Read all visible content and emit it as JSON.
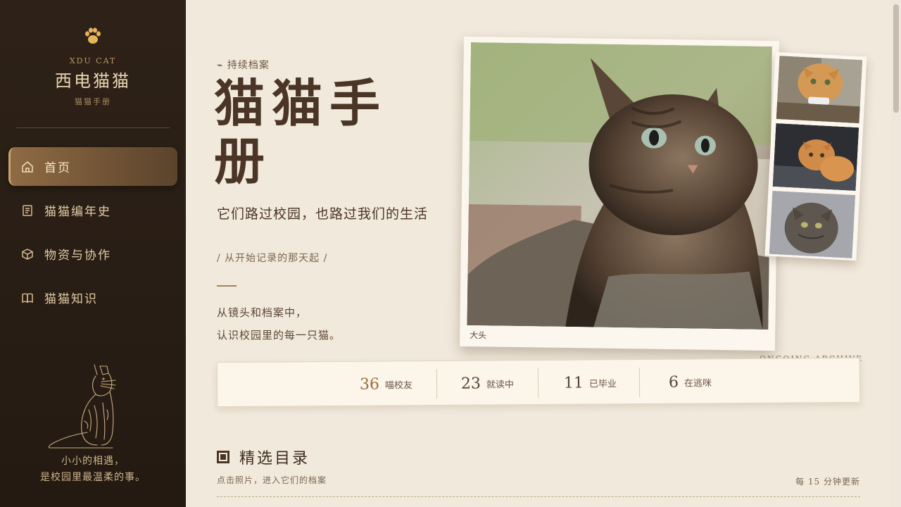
{
  "sidebar": {
    "brand_en": "XDU CAT",
    "brand_zh": "西电猫猫",
    "brand_sub": "猫猫手册",
    "nav": [
      {
        "label": "首页",
        "icon": "home-icon",
        "active": true
      },
      {
        "label": "猫猫编年史",
        "icon": "document-icon",
        "active": false
      },
      {
        "label": "物资与协作",
        "icon": "box-icon",
        "active": false
      },
      {
        "label": "猫猫知识",
        "icon": "book-icon",
        "active": false
      }
    ],
    "quote_line1": "小小的相遇，",
    "quote_line2": "是校园里最温柔的事。"
  },
  "hero": {
    "eyebrow": "⌁ 持续档案",
    "title": "猫猫手册",
    "subtitle": "它们路过校园，也路过我们的生活",
    "subtitle2": "/ 从开始记录的那天起 /",
    "desc_line1": "从镜头和档案中，",
    "desc_line2": "认识校园里的每一只猫。",
    "photo_caption": "大头",
    "archive_label": "ONGOING ARCHIVE"
  },
  "stats": [
    {
      "num": "36",
      "label": "喵校友"
    },
    {
      "num": "23",
      "label": "就读中"
    },
    {
      "num": "11",
      "label": "已毕业"
    },
    {
      "num": "6",
      "label": "在逃咪"
    }
  ],
  "section": {
    "title": "精选目录",
    "hint": "点击照片，进入它们的档案",
    "update": "每 15 分钟更新"
  },
  "colors": {
    "sidebar_bg": "#2a1f16",
    "accent_gold": "#c9a46d",
    "page_bg": "#f1e9dc",
    "text_dark": "#4a3526",
    "stat_accent": "#9a6e3e"
  }
}
